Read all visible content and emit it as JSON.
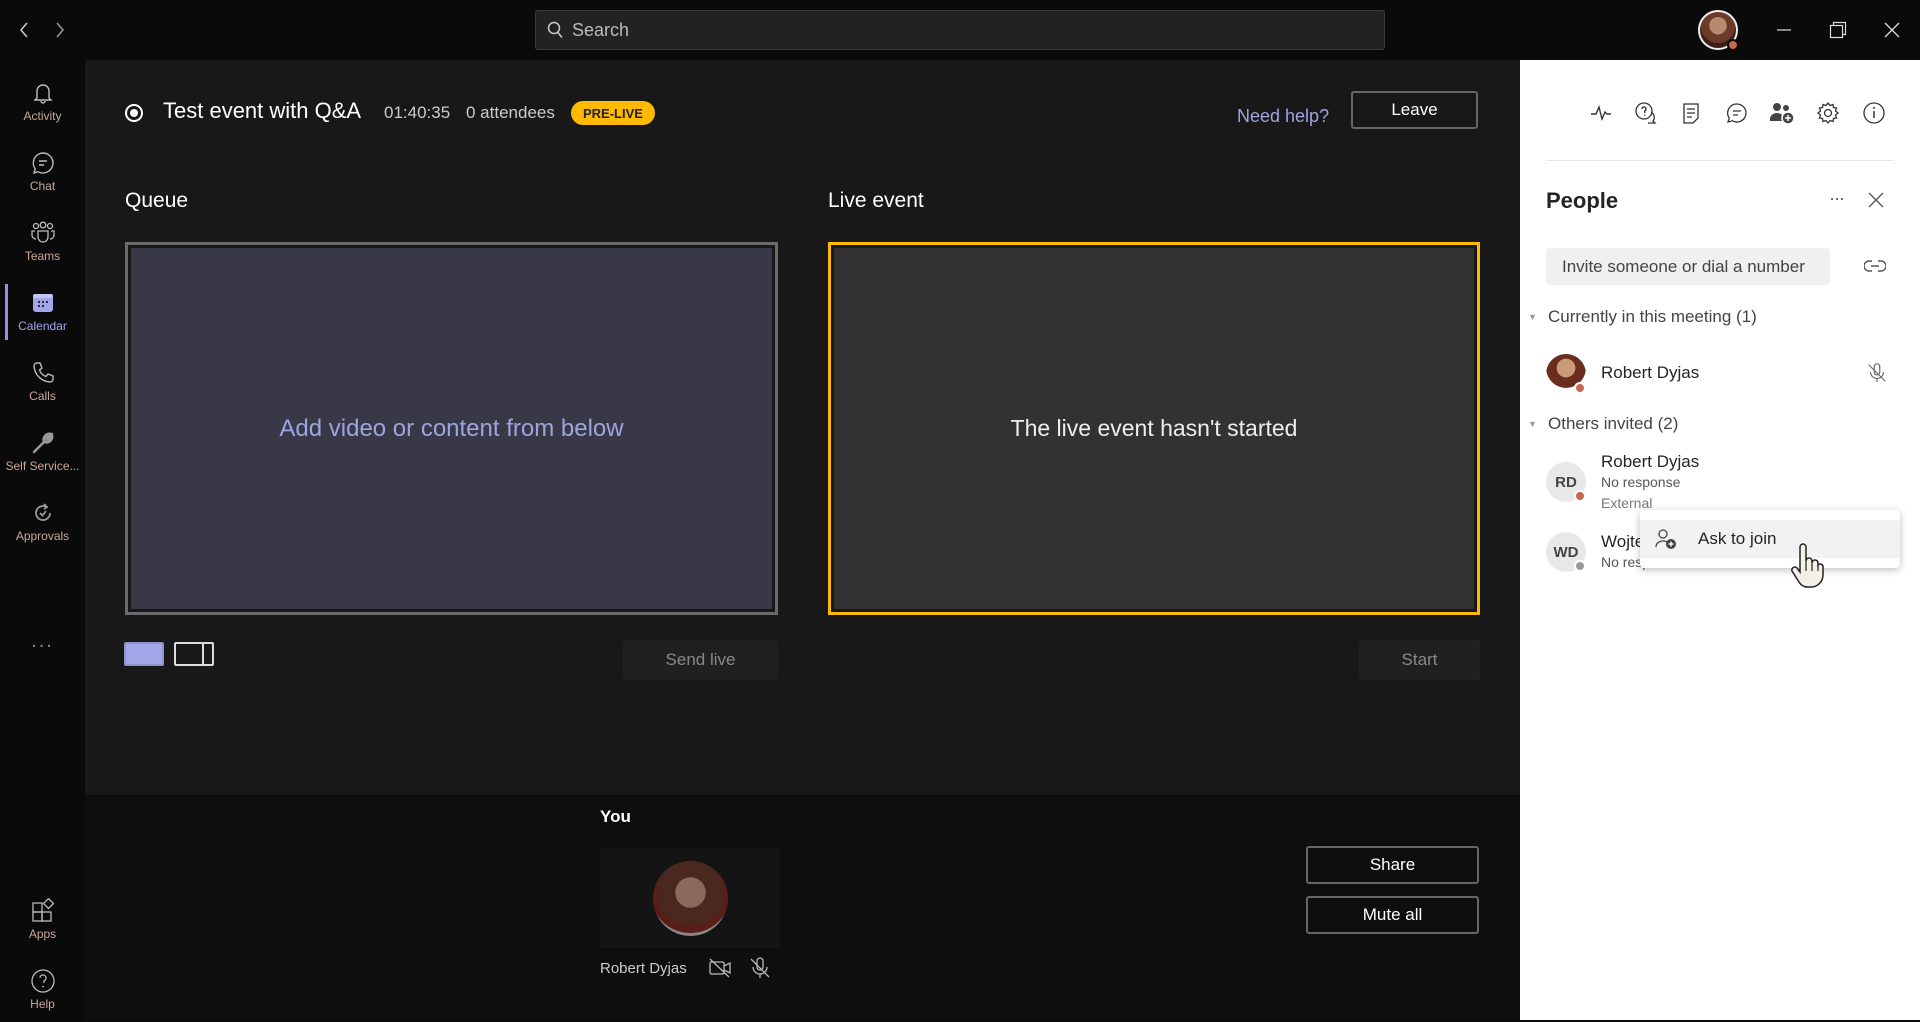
{
  "titlebar": {
    "back_label": "<",
    "forward_label": ">",
    "search_placeholder": "Search",
    "user_presence": "busy",
    "minimize_label": "Minimize",
    "maximize_label": "Restore",
    "close_label": "Close"
  },
  "rail": {
    "items": [
      {
        "label": "Activity",
        "icon": "bell-icon"
      },
      {
        "label": "Chat",
        "icon": "chat-icon"
      },
      {
        "label": "Teams",
        "icon": "teams-icon"
      },
      {
        "label": "Calendar",
        "icon": "calendar-icon",
        "active": true
      },
      {
        "label": "Calls",
        "icon": "phone-icon"
      },
      {
        "label": "Self Service...",
        "icon": "wrench-icon"
      },
      {
        "label": "Approvals",
        "icon": "approvals-icon"
      }
    ],
    "more_label": "...",
    "bottom_items": [
      {
        "label": "Apps",
        "icon": "apps-icon"
      },
      {
        "label": "Help",
        "icon": "help-icon"
      }
    ]
  },
  "event": {
    "title": "Test event with Q&A",
    "elapsed": "01:40:35",
    "attendees": "0 attendees",
    "status_badge": "PRE-LIVE",
    "need_help": "Need help?",
    "leave_label": "Leave"
  },
  "queue": {
    "title": "Queue",
    "placeholder": "Add video or content from below",
    "send_live_label": "Send live"
  },
  "live": {
    "title": "Live event",
    "status_text": "The live event hasn't started",
    "start_label": "Start"
  },
  "you": {
    "title": "You",
    "name": "Robert Dyjas",
    "share_label": "Share",
    "mute_all_label": "Mute all"
  },
  "panel": {
    "title": "People",
    "more_label": "...",
    "invite_placeholder": "Invite someone or dial a number",
    "current_group": "Currently in this meeting (1)",
    "current": [
      {
        "name": "Robert Dyjas",
        "muted": true
      }
    ],
    "invited_group": "Others invited (2)",
    "invited": [
      {
        "initials": "RD",
        "name": "Robert Dyjas",
        "status": "No response",
        "tag": "External"
      },
      {
        "initials": "WD",
        "name": "Wojte",
        "status": "No response"
      }
    ],
    "context_menu": {
      "ask_to_join": "Ask to join"
    }
  },
  "colors": {
    "accent": "#8f92e6",
    "live_border": "#ffb900",
    "badge_bg": "#ffb900",
    "presence_busy": "#c4674a"
  }
}
